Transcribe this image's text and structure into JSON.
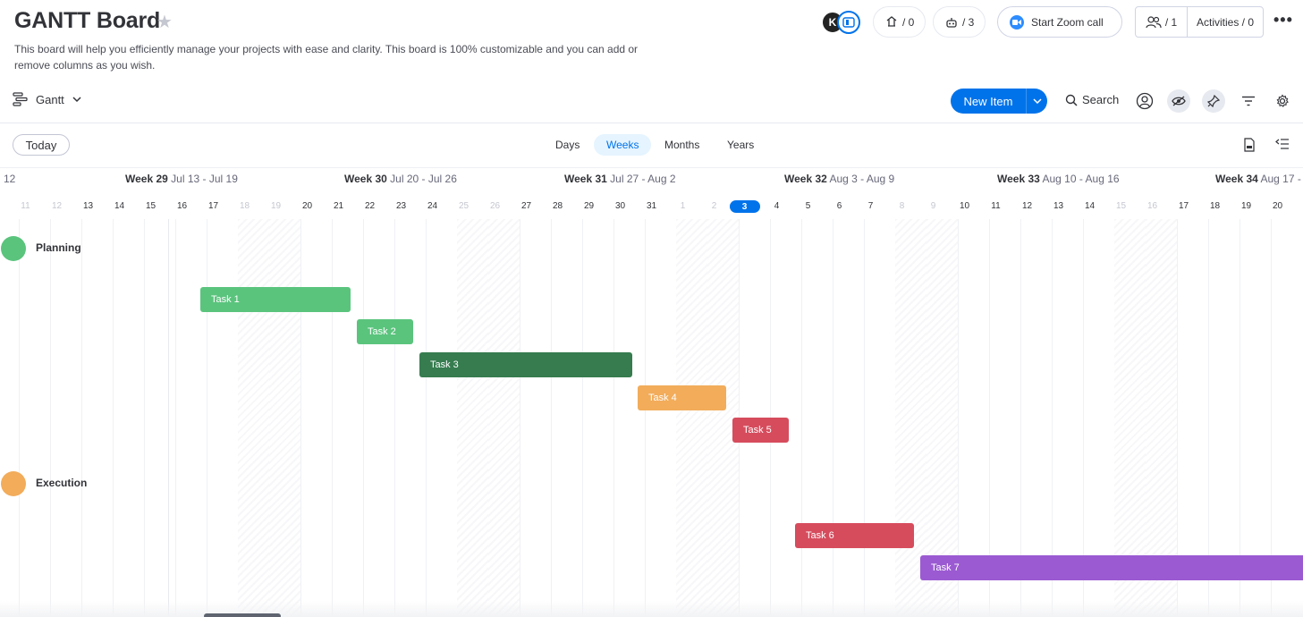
{
  "board": {
    "title": "GANTT Board",
    "description": "This board will help you efficiently manage your projects with ease and clarity. This board is 100% customizable and you can add or remove columns as you wish."
  },
  "header": {
    "avatar_initial": "K",
    "updates": "/ 0",
    "integrations": "/ 3",
    "zoom_label": "Start Zoom call",
    "members": "/ 1",
    "activities": "Activities / 0"
  },
  "toolbar": {
    "view_label": "Gantt",
    "new_item": "New Item",
    "search": "Search"
  },
  "timeline": {
    "today": "Today",
    "scales": [
      "Days",
      "Weeks",
      "Months",
      "Years"
    ],
    "active_scale": "Weeks",
    "first_week_fragment": "12",
    "weeks": [
      {
        "name": "Week 29",
        "range": "Jul 13 - Jul 19"
      },
      {
        "name": "Week 30",
        "range": "Jul 20 - Jul 26"
      },
      {
        "name": "Week 31",
        "range": "Jul 27 - Aug 2"
      },
      {
        "name": "Week 32",
        "range": "Aug 3 - Aug 9"
      },
      {
        "name": "Week 33",
        "range": "Aug 10 - Aug 16"
      },
      {
        "name": "Week 34",
        "range": "Aug 17 -"
      }
    ],
    "days": [
      "11",
      "12",
      "13",
      "14",
      "15",
      "16",
      "17",
      "18",
      "19",
      "20",
      "21",
      "22",
      "23",
      "24",
      "25",
      "26",
      "27",
      "28",
      "29",
      "30",
      "31",
      "1",
      "2",
      "3",
      "4",
      "5",
      "6",
      "7",
      "8",
      "9",
      "10",
      "11",
      "12",
      "13",
      "14",
      "15",
      "16",
      "17",
      "18",
      "19",
      "20"
    ],
    "weekend_days": [
      0,
      1,
      7,
      8,
      14,
      15,
      21,
      22,
      28,
      29,
      35,
      36
    ],
    "today_index": 23
  },
  "groups": [
    {
      "name": "Planning",
      "color": "#5ac47d"
    },
    {
      "name": "Execution",
      "color": "#f2ac5a"
    }
  ],
  "tasks": [
    {
      "label": "Task 1",
      "color": "#5ac47d"
    },
    {
      "label": "Task 2",
      "color": "#5ac47d"
    },
    {
      "label": "Task 3",
      "color": "#367c4f"
    },
    {
      "label": "Task 4",
      "color": "#f2ac5a"
    },
    {
      "label": "Task 5",
      "color": "#d64c5d"
    },
    {
      "label": "Task 6",
      "color": "#d64c5d"
    },
    {
      "label": "Task 7",
      "color": "#9b5ad2"
    }
  ]
}
